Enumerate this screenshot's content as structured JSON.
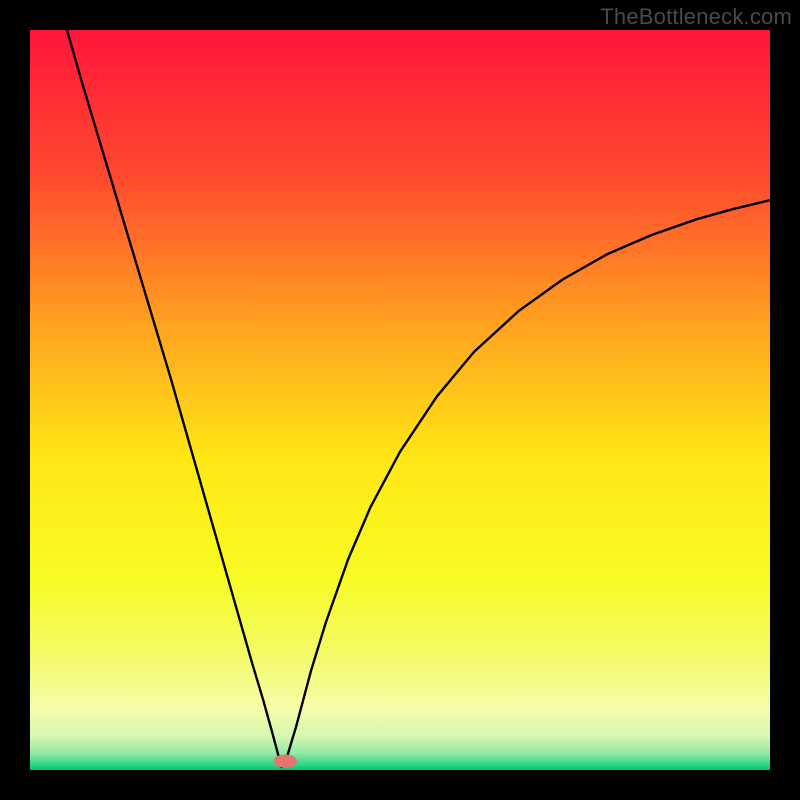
{
  "watermark": "TheBottleneck.com",
  "chart_data": {
    "type": "line",
    "title": "",
    "xlabel": "",
    "ylabel": "",
    "xlim": [
      0,
      100
    ],
    "ylim": [
      0,
      100
    ],
    "min_x": 34,
    "gradient_stops": [
      {
        "offset": 0.0,
        "color": "#ff163a"
      },
      {
        "offset": 0.2,
        "color": "#ff4a2e"
      },
      {
        "offset": 0.4,
        "color": "#ffa320"
      },
      {
        "offset": 0.58,
        "color": "#ffe714"
      },
      {
        "offset": 0.74,
        "color": "#f8fb24"
      },
      {
        "offset": 0.84,
        "color": "#f3fb65"
      },
      {
        "offset": 0.915,
        "color": "#f6fca8"
      },
      {
        "offset": 0.955,
        "color": "#d6f7b2"
      },
      {
        "offset": 0.978,
        "color": "#8fe9a5"
      },
      {
        "offset": 0.992,
        "color": "#33d887"
      },
      {
        "offset": 1.0,
        "color": "#00c46a"
      }
    ],
    "marker": {
      "x": 34.5,
      "y": 1.2,
      "rx": 1.6,
      "ry": 0.9,
      "color": "#e2776f"
    },
    "curve_left": [
      {
        "x": 5.0,
        "y": 100.0
      },
      {
        "x": 7.0,
        "y": 93.0
      },
      {
        "x": 10.0,
        "y": 83.0
      },
      {
        "x": 13.0,
        "y": 73.0
      },
      {
        "x": 16.0,
        "y": 63.0
      },
      {
        "x": 19.0,
        "y": 53.0
      },
      {
        "x": 22.0,
        "y": 42.5
      },
      {
        "x": 25.0,
        "y": 32.0
      },
      {
        "x": 28.0,
        "y": 21.5
      },
      {
        "x": 30.0,
        "y": 14.5
      },
      {
        "x": 31.5,
        "y": 9.5
      },
      {
        "x": 32.7,
        "y": 5.2
      },
      {
        "x": 33.5,
        "y": 2.2
      },
      {
        "x": 34.0,
        "y": 0.4
      }
    ],
    "curve_right": [
      {
        "x": 34.0,
        "y": 0.4
      },
      {
        "x": 34.8,
        "y": 2.0
      },
      {
        "x": 36.0,
        "y": 6.0
      },
      {
        "x": 38.0,
        "y": 13.5
      },
      {
        "x": 40.0,
        "y": 20.0
      },
      {
        "x": 43.0,
        "y": 28.5
      },
      {
        "x": 46.0,
        "y": 35.5
      },
      {
        "x": 50.0,
        "y": 43.0
      },
      {
        "x": 55.0,
        "y": 50.5
      },
      {
        "x": 60.0,
        "y": 56.5
      },
      {
        "x": 66.0,
        "y": 62.0
      },
      {
        "x": 72.0,
        "y": 66.3
      },
      {
        "x": 78.0,
        "y": 69.7
      },
      {
        "x": 84.0,
        "y": 72.3
      },
      {
        "x": 90.0,
        "y": 74.4
      },
      {
        "x": 95.0,
        "y": 75.8
      },
      {
        "x": 100.0,
        "y": 77.0
      }
    ]
  }
}
